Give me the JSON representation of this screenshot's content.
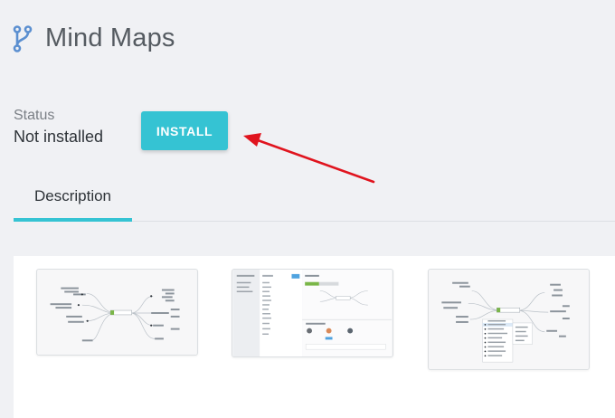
{
  "header": {
    "title": "Mind Maps",
    "icon": "branch-icon",
    "icon_color": "#5b8fd0"
  },
  "status": {
    "label": "Status",
    "value": "Not installed"
  },
  "install_button": {
    "label": "INSTALL",
    "color": "#35c3d3"
  },
  "annotation": {
    "arrow_color": "#e0141e"
  },
  "tabs": [
    {
      "label": "Description",
      "active": true
    }
  ],
  "accent_color": "#35c3d3",
  "screenshots": [
    {
      "kind": "mind-map-overview"
    },
    {
      "kind": "mind-map-editor"
    },
    {
      "kind": "mind-map-context-menu"
    }
  ]
}
